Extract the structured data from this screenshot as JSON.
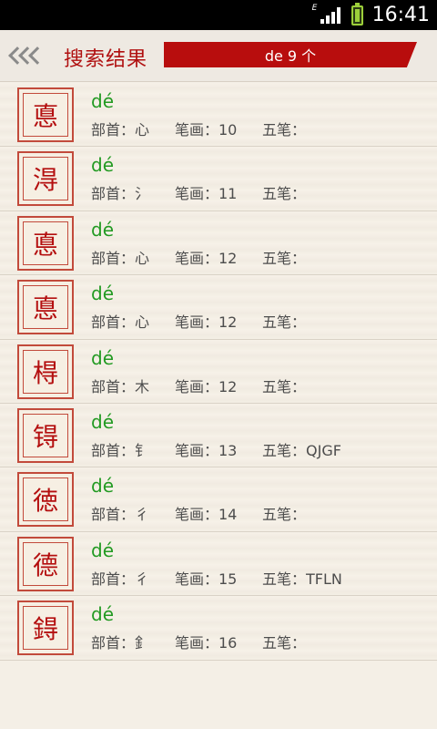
{
  "status": {
    "signal_label": "E",
    "time": "16:41"
  },
  "header": {
    "title": "搜索结果",
    "result_summary": "de 9 个"
  },
  "labels": {
    "radical": "部首：",
    "strokes": "笔画：",
    "wubi": "五笔："
  },
  "results": [
    {
      "char": "悳",
      "pinyin": "dé",
      "radical": "心",
      "strokes": "10",
      "wubi": ""
    },
    {
      "char": "淂",
      "pinyin": "dé",
      "radical": "氵",
      "strokes": "11",
      "wubi": ""
    },
    {
      "char": "悳",
      "pinyin": "dé",
      "radical": "心",
      "strokes": "12",
      "wubi": ""
    },
    {
      "char": "悳",
      "pinyin": "dé",
      "radical": "心",
      "strokes": "12",
      "wubi": ""
    },
    {
      "char": "棏",
      "pinyin": "dé",
      "radical": "木",
      "strokes": "12",
      "wubi": ""
    },
    {
      "char": "锝",
      "pinyin": "dé",
      "radical": "钅",
      "strokes": "13",
      "wubi": "QJGF"
    },
    {
      "char": "徳",
      "pinyin": "dé",
      "radical": "彳",
      "strokes": "14",
      "wubi": ""
    },
    {
      "char": "德",
      "pinyin": "dé",
      "radical": "彳",
      "strokes": "15",
      "wubi": "TFLN"
    },
    {
      "char": "鍀",
      "pinyin": "dé",
      "radical": "釒",
      "strokes": "16",
      "wubi": ""
    }
  ]
}
